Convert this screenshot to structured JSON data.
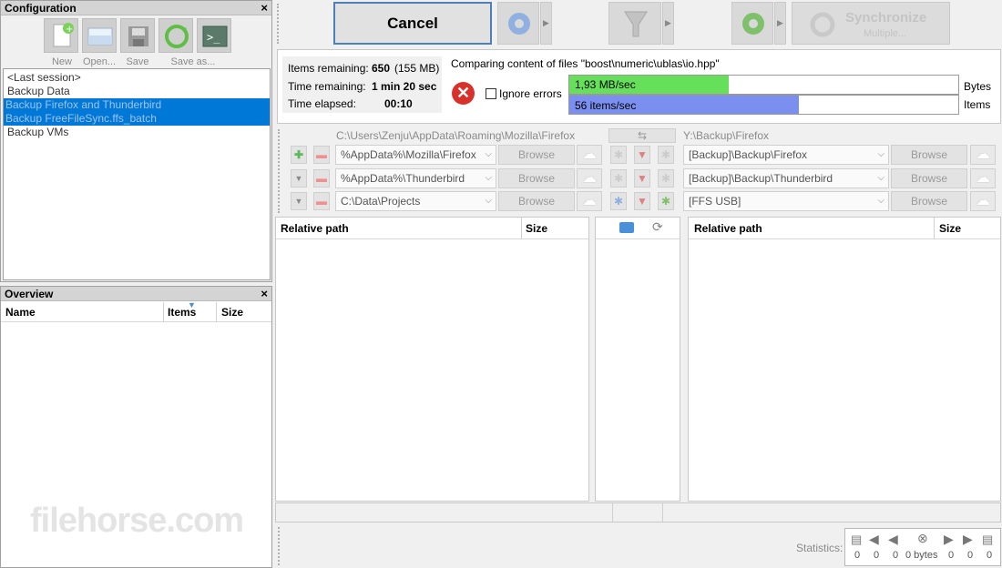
{
  "config_panel": {
    "title": "Configuration",
    "close": "×",
    "toolbar": [
      {
        "label": "New",
        "icon": "new-config-icon"
      },
      {
        "label": "Open...",
        "icon": "open-config-icon"
      },
      {
        "label": "Save",
        "icon": "save-icon"
      },
      {
        "label": "Save as...",
        "icon": "save-as-icon"
      }
    ],
    "items": [
      {
        "label": "<Last session>",
        "selected": false
      },
      {
        "label": "Backup Data",
        "selected": false
      },
      {
        "label": "Backup Firefox and Thunderbird",
        "selected": true
      },
      {
        "label": "Backup FreeFileSync.ffs_batch",
        "selected": true
      },
      {
        "label": "Backup VMs",
        "selected": false
      }
    ]
  },
  "overview_panel": {
    "title": "Overview",
    "close": "×",
    "columns": [
      "Name",
      "Items",
      "Size"
    ]
  },
  "top_toolbar": {
    "cancel_label": "Cancel",
    "sync_label": "Synchronize",
    "sync_sub": "Multiple..."
  },
  "progress": {
    "items_remaining_label": "Items remaining:",
    "items_remaining_value": "650",
    "items_remaining_size": "(155 MB)",
    "time_remaining_label": "Time remaining:",
    "time_remaining_value": "1 min 20 sec",
    "time_elapsed_label": "Time elapsed:",
    "time_elapsed_value": "00:10",
    "status_text": "Comparing content of files \"boost\\numeric\\ublas\\io.hpp\"",
    "ignore_errors_label": "Ignore errors",
    "bytes_rate": "1,93 MB/sec",
    "bytes_fraction": 0.41,
    "bytes_label": "Bytes",
    "items_rate": "56 items/sec",
    "items_fraction": 0.59,
    "items_label": "Items",
    "bytes_color": "#66e05a",
    "items_color": "#7b8ff0"
  },
  "folders": {
    "left_header": "C:\\Users\\Zenju\\AppData\\Roaming\\Mozilla\\Firefox",
    "right_header": "Y:\\Backup\\Firefox",
    "browse_label": "Browse",
    "pairs": [
      {
        "left": "%AppData%\\Mozilla\\Firefox",
        "right": "[Backup]\\Backup\\Firefox"
      },
      {
        "left": "%AppData%\\Thunderbird",
        "right": "[Backup]\\Backup\\Thunderbird"
      },
      {
        "left": "C:\\Data\\Projects",
        "right": "[FFS USB]"
      }
    ]
  },
  "grid": {
    "left_cols": [
      "Relative path",
      "Size"
    ],
    "right_cols": [
      "Relative path",
      "Size"
    ]
  },
  "statistics": {
    "label": "Statistics:",
    "values": [
      "0",
      "0",
      "0",
      "0 bytes",
      "0",
      "0",
      "0"
    ]
  },
  "watermark": "filehorse.com"
}
